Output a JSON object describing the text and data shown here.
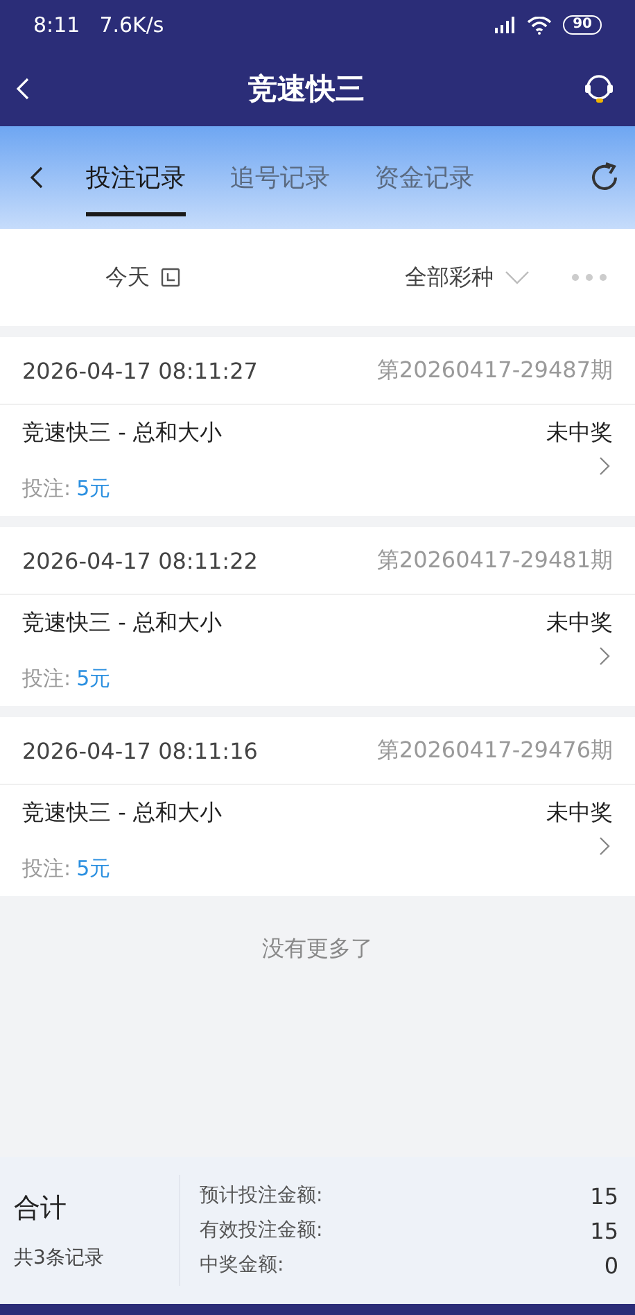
{
  "status_bar": {
    "time": "8:11",
    "speed": "7.6K/s",
    "battery": "90"
  },
  "header": {
    "title": "竞速快三"
  },
  "tabs": [
    {
      "label": "投注记录",
      "selected": true
    },
    {
      "label": "追号记录",
      "selected": false
    },
    {
      "label": "资金记录",
      "selected": false
    }
  ],
  "filters": {
    "date": "今天",
    "lottery": "全部彩种"
  },
  "records": [
    {
      "time": "2026-04-17 08:11:27",
      "issue": "第20260417-29487期",
      "game": "竞速快三 - 总和大小",
      "result": "未中奖",
      "bet_label": "投注:",
      "bet_amount": "5元"
    },
    {
      "time": "2026-04-17 08:11:22",
      "issue": "第20260417-29481期",
      "game": "竞速快三 - 总和大小",
      "result": "未中奖",
      "bet_label": "投注:",
      "bet_amount": "5元"
    },
    {
      "time": "2026-04-17 08:11:16",
      "issue": "第20260417-29476期",
      "game": "竞速快三 - 总和大小",
      "result": "未中奖",
      "bet_label": "投注:",
      "bet_amount": "5元"
    }
  ],
  "end_note": "没有更多了",
  "summary": {
    "title": "合计",
    "count": "共3条记录",
    "rows": [
      {
        "label": "预计投注金额:",
        "value": "15"
      },
      {
        "label": "有效投注金额:",
        "value": "15"
      },
      {
        "label": "中奖金额:",
        "value": "0"
      }
    ]
  }
}
